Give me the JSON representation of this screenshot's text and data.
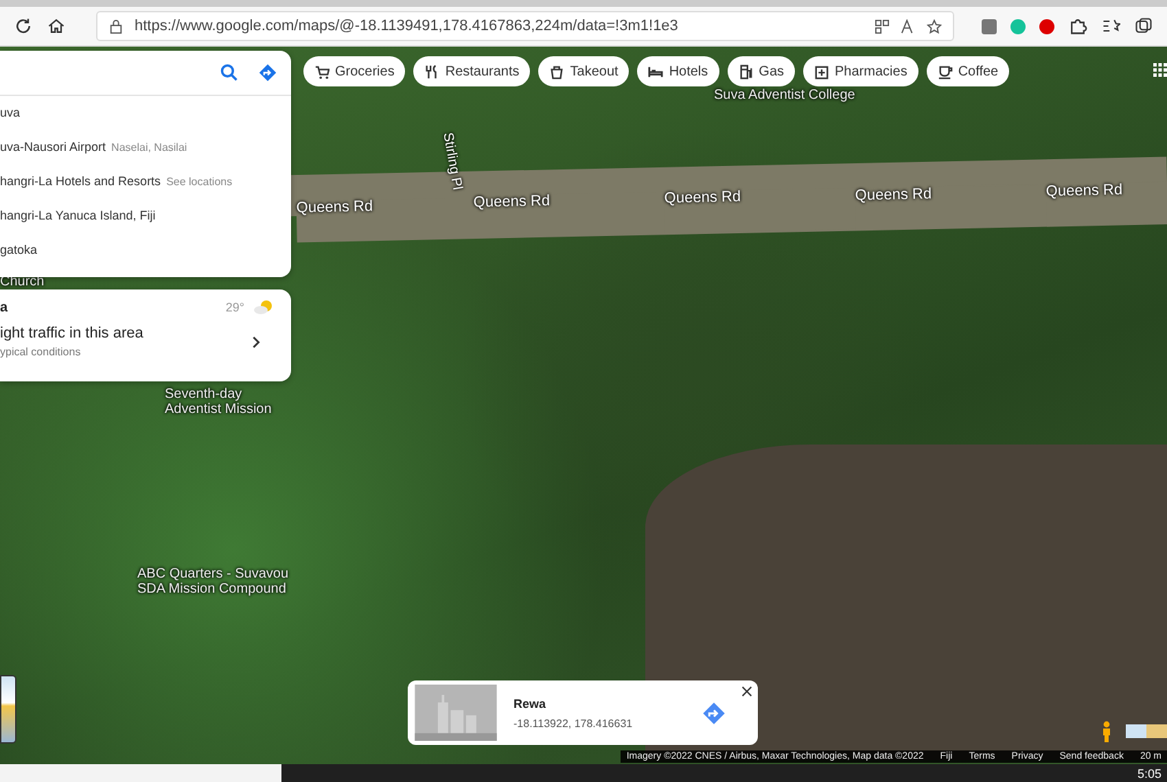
{
  "browser": {
    "url": "https://www.google.com/maps/@-18.1139491,178.4167863,224m/data=!3m1!1e3"
  },
  "search_panel": {
    "suggestions": [
      {
        "name": "uva"
      },
      {
        "name": "uva-Nausori Airport",
        "detail": "Naselai, Nasilai"
      },
      {
        "name": "hangri-La Hotels and Resorts",
        "detail": "See locations"
      },
      {
        "name": "hangri-La Yanuca Island, Fiji"
      },
      {
        "name": "gatoka"
      }
    ]
  },
  "weather_card": {
    "place": "a",
    "temperature": "29°",
    "traffic": "ight traffic in this area",
    "conditions": "ypical conditions"
  },
  "chips": [
    {
      "kind": "cart",
      "label": "Groceries"
    },
    {
      "kind": "cutlery",
      "label": "Restaurants"
    },
    {
      "kind": "bag",
      "label": "Takeout"
    },
    {
      "kind": "bed",
      "label": "Hotels"
    },
    {
      "kind": "pump",
      "label": "Gas"
    },
    {
      "kind": "cross",
      "label": "Pharmacies"
    },
    {
      "kind": "cup",
      "label": "Coffee"
    }
  ],
  "map_labels": [
    {
      "kind": "road",
      "text": "Queens Rd"
    },
    {
      "kind": "road",
      "text": "Queens Rd"
    },
    {
      "kind": "road",
      "text": "Queens Rd"
    },
    {
      "kind": "road",
      "text": "Queens Rd"
    },
    {
      "kind": "road",
      "text": "Queens Rd"
    },
    {
      "kind": "street",
      "text": "Stirling Pl"
    },
    {
      "kind": "place",
      "text": "Suva Adventist College"
    },
    {
      "kind": "place",
      "text": "Seventh-day Adventist Mission"
    },
    {
      "kind": "place",
      "text": "ABC Quarters - Suvavou SDA Mission Compound"
    },
    {
      "kind": "place",
      "text": "Church"
    }
  ],
  "place_card": {
    "title": "Rewa",
    "coordinates": "-18.113922, 178.416631"
  },
  "footer": {
    "attribution": "Imagery ©2022 CNES / Airbus, Maxar Technologies, Map data ©2022",
    "links": [
      "Fiji",
      "Terms",
      "Privacy",
      "Send feedback"
    ],
    "scale": "20 m"
  },
  "taskbar": {
    "time": "5:05"
  }
}
